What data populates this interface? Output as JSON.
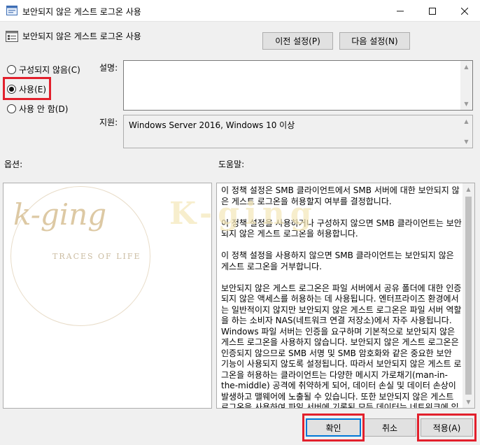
{
  "window": {
    "title": "보안되지 않은 게스트 로그온 사용"
  },
  "header": {
    "title": "보안되지 않은 게스트 로그온 사용",
    "prev_label": "이전 설정(P)",
    "next_label": "다음 설정(N)"
  },
  "state": {
    "options": [
      {
        "label": "구성되지 않음(C)",
        "selected": false
      },
      {
        "label": "사용(E)",
        "selected": true
      },
      {
        "label": "사용 안 함(D)",
        "selected": false
      }
    ]
  },
  "comment": {
    "label": "설명:",
    "value": ""
  },
  "support": {
    "label": "지원:",
    "value": "Windows Server 2016, Windows 10 이상"
  },
  "options_panel": {
    "label": "옵션:"
  },
  "help": {
    "label": "도움말:",
    "paragraphs": [
      "이 정책 설정은 SMB 클라이언트에서 SMB 서버에 대한 보안되지 않은 게스트 로그온을 허용할지 여부를 결정합니다.",
      "이 정책 설정을 사용하거나 구성하지 않으면 SMB 클라이언트는 보안되지 않은 게스트 로그온을 허용합니다.",
      "이 정책 설정을 사용하지 않으면 SMB 클라이언트는 보안되지 않은 게스트 로그온을 거부합니다.",
      "보안되지 않은 게스트 로그온은 파일 서버에서 공유 폴더에 대한 인증되지 않은 액세스를 허용하는 데 사용됩니다. 엔터프라이즈 환경에서는 일반적이지 않지만 보안되지 않은 게스트 로그온은 파일 서버 역할을 하는 소비자 NAS(네트워크 연결 저장소)에서 자주 사용됩니다. Windows 파일 서버는 인증을 요구하며 기본적으로 보안되지 않은 게스트 로그온을 사용하지 않습니다. 보안되지 않은 게스트 로그온은 인증되지 않으므로 SMB 서명 및 SMB 암호화와 같은 중요한 보안 기능이 사용되지 않도록 설정됩니다. 따라서 보안되지 않은 게스트 로그온을 허용하는 클라이언트는 다양한 메시지 가로채기(man-in-the-middle) 공격에 취약하게 되어, 데이터 손실 및 데이터 손상이 발생하고 맬웨어에 노출될 수 있습니다. 또한 보안되지 않은 게스트 로그온을 사용하여 파일 서버에 기록된 모든 데이터는 네트워크에 있는 누구에게나"
    ]
  },
  "footer": {
    "ok_label": "확인",
    "cancel_label": "취소",
    "apply_label": "적용(A)"
  },
  "watermark": {
    "script": "k-ging",
    "tagline": "TRACES OF LIFE",
    "text": "K-ging"
  },
  "colors": {
    "highlight": "#e2202c",
    "focus_border": "#0078d7",
    "watermark": "#ddc9a4"
  }
}
